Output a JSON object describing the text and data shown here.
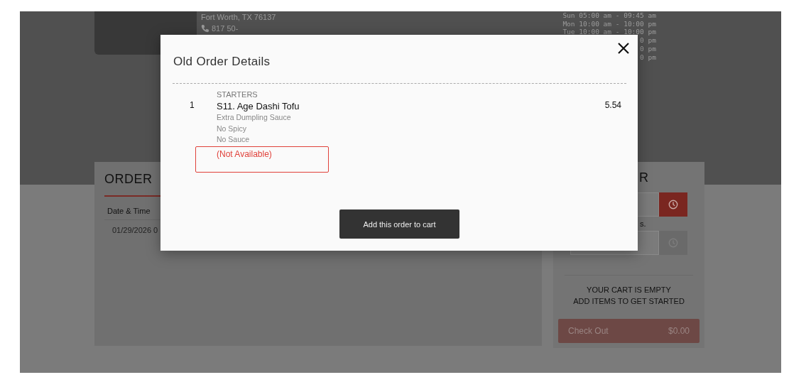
{
  "restaurant": {
    "address": "Fort Worth, TX 76137",
    "phone": "817 50-",
    "hours": [
      "Sun 05:00 am - 09:45 am",
      "Mon 10:00 am - 10:00 pm",
      "Tue 10:00 am - 10:00 pm",
      "0 pm",
      "0 pm",
      "0 pm"
    ]
  },
  "order_history": {
    "title": "ORDER",
    "columns": [
      "Date & Time"
    ],
    "rows": [
      [
        "01/29/2026 0"
      ]
    ]
  },
  "order_panel": {
    "title": "R",
    "note": "s.",
    "cart_message": [
      "YOUR CART IS EMPTY",
      "ADD ITEMS TO GET STARTED"
    ],
    "checkout": {
      "label": "Check Out",
      "total": "$0.00"
    }
  },
  "modal": {
    "title": "Old Order Details",
    "items": [
      {
        "qty": "1",
        "category": "STARTERS",
        "name": "S11. Age Dashi Tofu",
        "modifiers": [
          "Extra Dumpling Sauce",
          "No Spicy",
          "No Sauce"
        ],
        "available": false,
        "unavailable_note": "(Not Available)",
        "price": "5.54"
      }
    ],
    "action": "Add this order to cart"
  }
}
